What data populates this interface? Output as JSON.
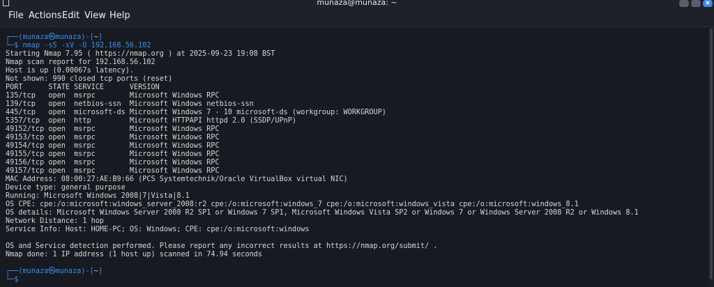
{
  "window": {
    "title": "munaza@munaza: ~"
  },
  "menu": [
    "File",
    "Actions",
    "Edit",
    "View",
    "Help"
  ],
  "prompt": {
    "open": "┌──(",
    "user": "munaza㉿munaza",
    "close": ")-[",
    "dir": "~",
    "end": "]",
    "arrow": "└─$ "
  },
  "command": "nmap -sS -sV -O 192.168.56.102",
  "output": [
    "Starting Nmap 7.95 ( https://nmap.org ) at 2025-09-23 19:08 BST",
    "Nmap scan report for 192.168.56.102",
    "Host is up (0.00067s latency).",
    "Not shown: 990 closed tcp ports (reset)",
    "PORT      STATE SERVICE      VERSION",
    "135/tcp   open  msrpc        Microsoft Windows RPC",
    "139/tcp   open  netbios-ssn  Microsoft Windows netbios-ssn",
    "445/tcp   open  microsoft-ds Microsoft Windows 7 - 10 microsoft-ds (workgroup: WORKGROUP)",
    "5357/tcp  open  http         Microsoft HTTPAPI httpd 2.0 (SSDP/UPnP)",
    "49152/tcp open  msrpc        Microsoft Windows RPC",
    "49153/tcp open  msrpc        Microsoft Windows RPC",
    "49154/tcp open  msrpc        Microsoft Windows RPC",
    "49155/tcp open  msrpc        Microsoft Windows RPC",
    "49156/tcp open  msrpc        Microsoft Windows RPC",
    "49157/tcp open  msrpc        Microsoft Windows RPC",
    "MAC Address: 08:00:27:AE:B9:66 (PCS Systemtechnik/Oracle VirtualBox virtual NIC)",
    "Device type: general purpose",
    "Running: Microsoft Windows 2008|7|Vista|8.1",
    "OS CPE: cpe:/o:microsoft:windows_server_2008:r2 cpe:/o:microsoft:windows_7 cpe:/o:microsoft:windows_vista cpe:/o:microsoft:windows_8.1",
    "OS details: Microsoft Windows Server 2008 R2 SP1 or Windows 7 SP1, Microsoft Windows Vista SP2 or Windows 7 or Windows Server 2008 R2 or Windows 8.1",
    "Network Distance: 1 hop",
    "Service Info: Host: HOME-PC; OS: Windows; CPE: cpe:/o:microsoft:windows",
    "",
    "OS and Service detection performed. Please report any incorrect results at https://nmap.org/submit/ .",
    "Nmap done: 1 IP address (1 host up) scanned in 74.94 seconds"
  ],
  "colors": {
    "background": "#171a21",
    "prompt": "#3b8eea",
    "text": "#d6d6d6"
  }
}
